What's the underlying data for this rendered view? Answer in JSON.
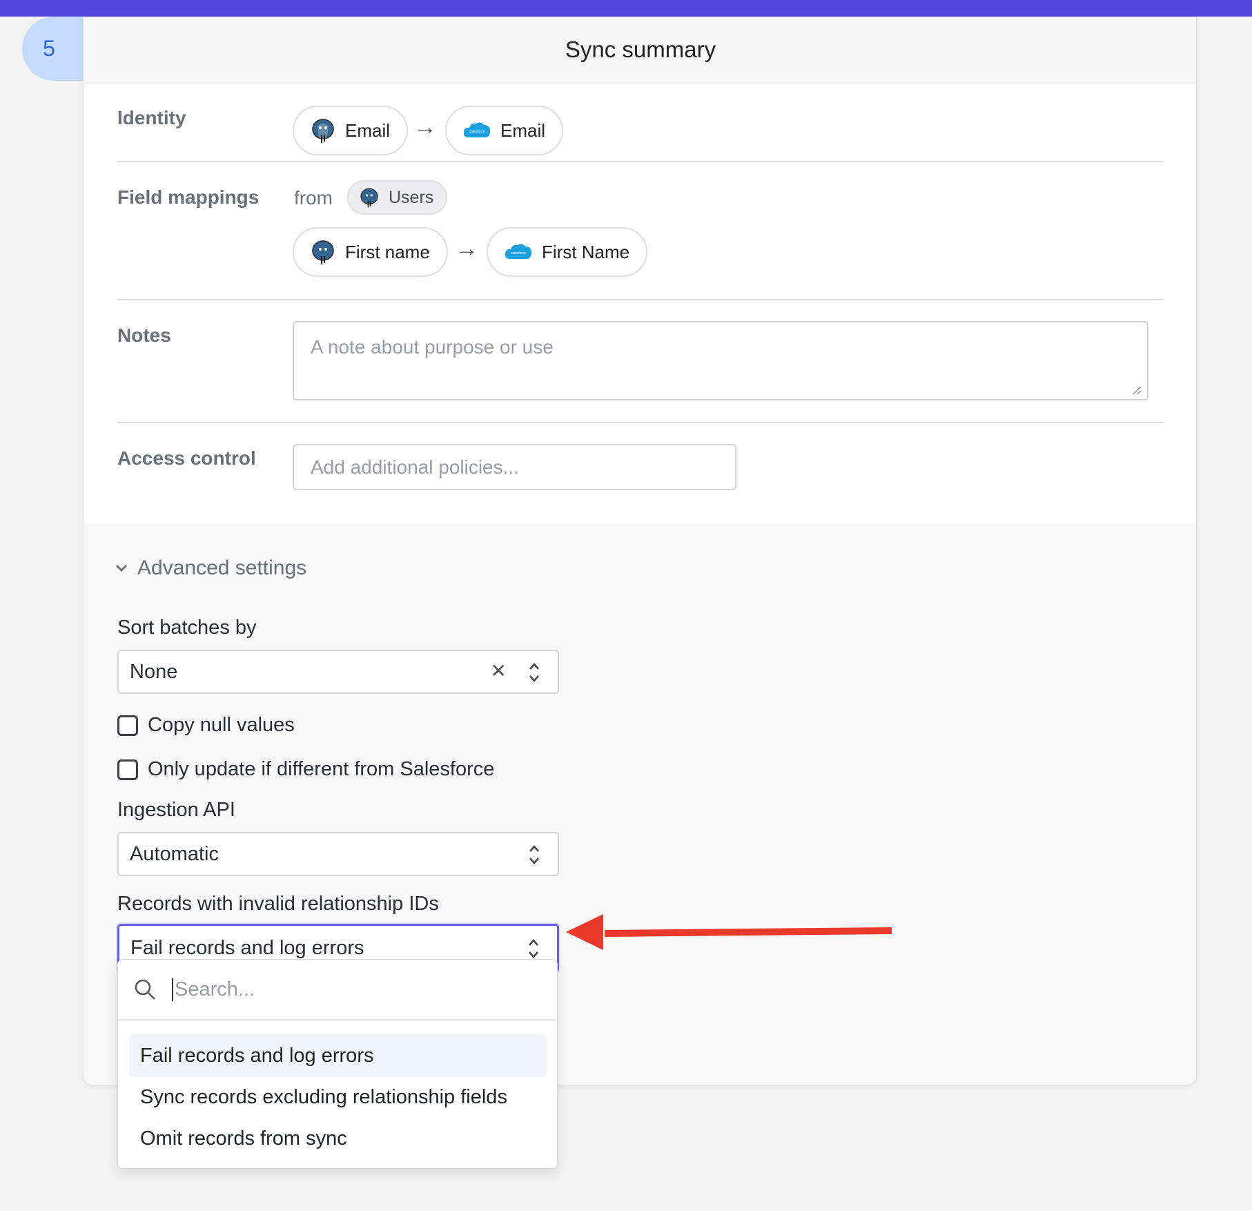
{
  "step_number": "5",
  "header_title": "Sync summary",
  "identity": {
    "label": "Identity",
    "source": "Email",
    "destination": "Email"
  },
  "field_mappings": {
    "label": "Field mappings",
    "from_text": "from",
    "source_table": "Users",
    "source_field": "First name",
    "destination_field": "First Name"
  },
  "notes": {
    "label": "Notes",
    "placeholder": "A note about purpose or use"
  },
  "access_control": {
    "label": "Access control",
    "placeholder": "Add additional policies..."
  },
  "advanced": {
    "toggle_label": "Advanced settings",
    "sort_batches_label": "Sort batches by",
    "sort_batches_value": "None",
    "copy_null_label": "Copy null values",
    "only_update_label": "Only update if different from Salesforce",
    "ingestion_api_label": "Ingestion API",
    "ingestion_api_value": "Automatic",
    "invalid_ids_label": "Records with invalid relationship IDs",
    "invalid_ids_value": "Fail records and log errors"
  },
  "dropdown": {
    "search_placeholder": "Search...",
    "options": [
      "Fail records and log errors",
      "Sync records excluding relationship fields",
      "Omit records from sync"
    ]
  },
  "icons": {
    "postgres": "postgres-icon",
    "salesforce": "salesforce-icon",
    "salesforce_text": "salesforce"
  },
  "colors": {
    "accent": "#5046dc",
    "badge": "#c4dbfb",
    "focus": "#6a5ee8",
    "annotation_arrow": "#e8392b",
    "salesforce": "#1ba0e1",
    "postgres": "#336791"
  }
}
